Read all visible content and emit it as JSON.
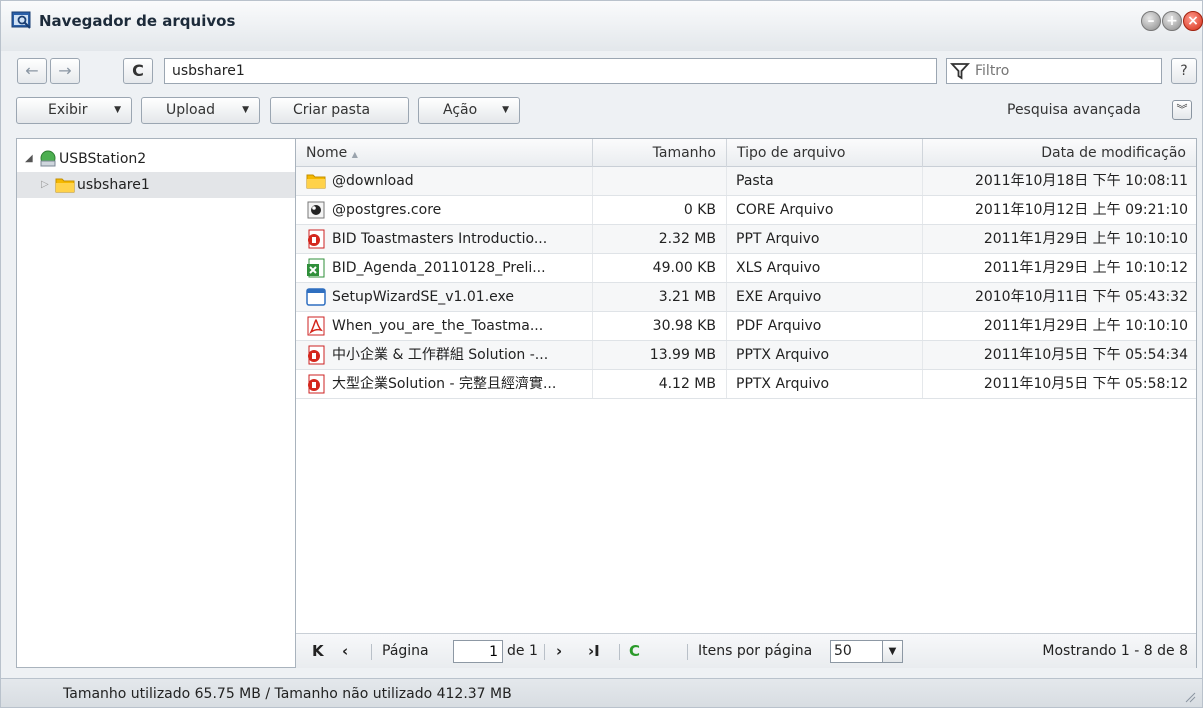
{
  "window": {
    "title": "Navegador de arquivos",
    "icon": "file-browser-icon"
  },
  "addressbar": {
    "path": "usbshare1",
    "filter_placeholder": "Filtro",
    "help_label": "?"
  },
  "toolbar": {
    "exibir_label": "Exibir",
    "upload_label": "Upload",
    "criar_pasta_label": "Criar pasta",
    "acao_label": "Ação",
    "advanced_search_label": "Pesquisa avançada"
  },
  "tree": {
    "root_label": "USBStation2",
    "child_label": "usbshare1"
  },
  "columns": {
    "name": "Nome",
    "size": "Tamanho",
    "type": "Tipo de arquivo",
    "date": "Data de modificação"
  },
  "files": [
    {
      "name": "@download",
      "size": "",
      "type": "Pasta",
      "date": "2011年10月18日 下午 10:08:11",
      "icon": "folder-icon"
    },
    {
      "name": "@postgres.core",
      "size": "0 KB",
      "type": "CORE Arquivo",
      "date": "2011年10月12日 上午 09:21:10",
      "icon": "core-file-icon"
    },
    {
      "name": "BID Toastmasters Introductio...",
      "size": "2.32 MB",
      "type": "PPT Arquivo",
      "date": "2011年1月29日 上午 10:10:10",
      "icon": "ppt-file-icon"
    },
    {
      "name": "BID_Agenda_20110128_Preli...",
      "size": "49.00 KB",
      "type": "XLS Arquivo",
      "date": "2011年1月29日 上午 10:10:12",
      "icon": "xls-file-icon"
    },
    {
      "name": "SetupWizardSE_v1.01.exe",
      "size": "3.21 MB",
      "type": "EXE Arquivo",
      "date": "2010年10月11日 下午 05:43:32",
      "icon": "exe-file-icon"
    },
    {
      "name": "When_you_are_the_Toastma...",
      "size": "30.98 KB",
      "type": "PDF Arquivo",
      "date": "2011年1月29日 上午 10:10:10",
      "icon": "pdf-file-icon"
    },
    {
      "name": "中小企業 & 工作群組 Solution -...",
      "size": "13.99 MB",
      "type": "PPTX Arquivo",
      "date": "2011年10月5日 下午 05:54:34",
      "icon": "pptx-file-icon"
    },
    {
      "name": "大型企業Solution - 完整且經濟實...",
      "size": "4.12 MB",
      "type": "PPTX Arquivo",
      "date": "2011年10月5日 下午 05:58:12",
      "icon": "pptx-file-icon"
    }
  ],
  "pager": {
    "page_label": "Página",
    "page_value": "1",
    "of_label": "de 1",
    "items_per_page_label": "Itens por página",
    "items_per_page_value": "50",
    "showing_label": "Mostrando 1 - 8 de 8"
  },
  "statusbar": {
    "text": "Tamanho utilizado 65.75 MB / Tamanho não utilizado 412.37 MB"
  },
  "colors": {
    "folder": "#f5b800",
    "ppt_red": "#d4271d",
    "xls_green": "#2f8f3a",
    "exe_blue": "#2f6fc0",
    "refresh_green": "#2a9a2a"
  }
}
